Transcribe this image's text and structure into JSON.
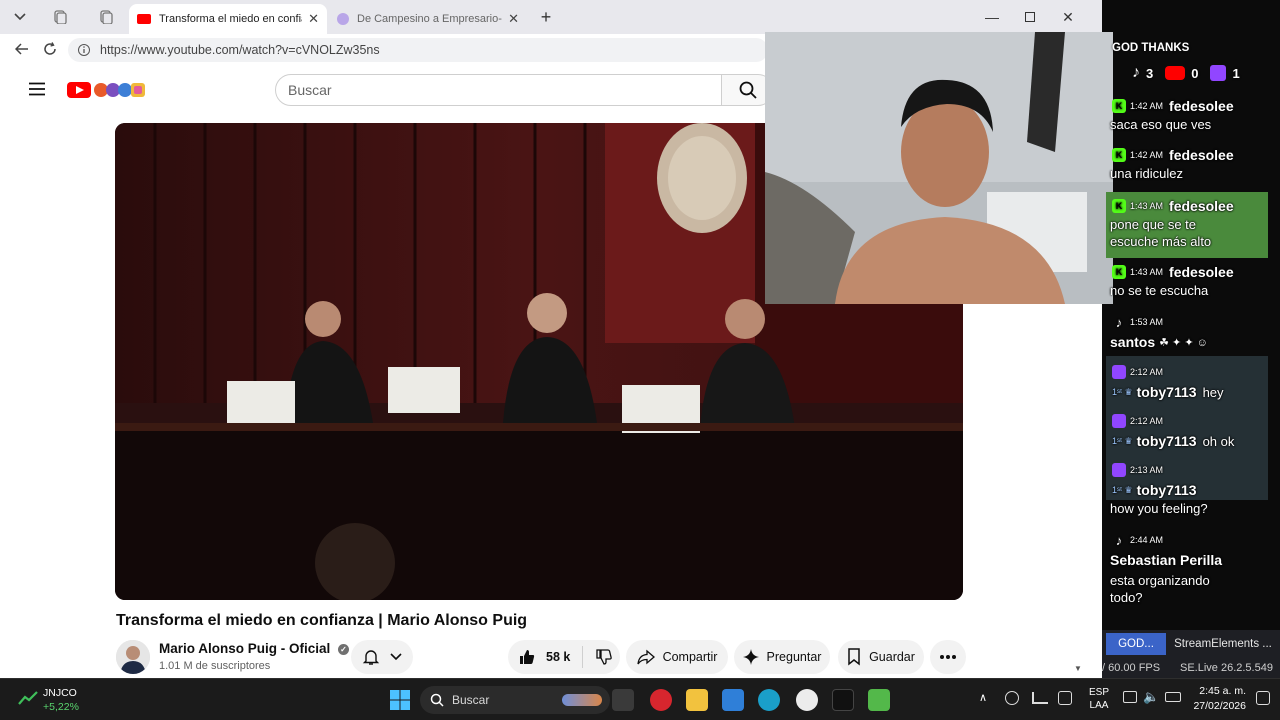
{
  "browser": {
    "tabs": [
      {
        "title": "Transforma el miedo en confianza",
        "active": true,
        "favicon_color": "#ff0000"
      },
      {
        "title": "De Campesino a Empresario- cómo",
        "active": false,
        "favicon_color": "#b9a6e8"
      }
    ],
    "new_tab_label": "+",
    "url": "https://www.youtube.com/watch?v=cVNOLZw35ns"
  },
  "youtube": {
    "search_placeholder": "Buscar",
    "video_title": "Transforma el miedo en confianza | Mario Alonso Puig",
    "channel_name": "Mario Alonso Puig - Oficial",
    "subscribers": "1.01 M de suscriptores",
    "likes": "58 k",
    "share_label": "Compartir",
    "ask_label": "Preguntar",
    "save_label": "Guardar"
  },
  "stream_overlay": {
    "banner": "GOD THANKS",
    "counts": {
      "tiktok": "3",
      "youtube": "0",
      "twitch": "1"
    },
    "messages": [
      {
        "platform": "kick",
        "time": "1:42 AM",
        "user": "fedesolee",
        "text": "saca eso que ves",
        "highlight": false
      },
      {
        "platform": "kick",
        "time": "1:42 AM",
        "user": "fedesolee",
        "text": "una ridiculez",
        "highlight": false
      },
      {
        "platform": "kick",
        "time": "1:43 AM",
        "user": "fedesolee",
        "text": "pone que se te escuche más alto",
        "highlight": true
      },
      {
        "platform": "kick",
        "time": "1:43 AM",
        "user": "fedesolee",
        "text": "no se te escucha",
        "highlight": false
      },
      {
        "platform": "tiktok",
        "time": "1:53 AM",
        "user": "santos",
        "text": "",
        "highlight": false
      },
      {
        "platform": "twitch",
        "time": "2:12 AM",
        "user": "toby7113",
        "text": "hey",
        "highlight": false,
        "inline": true
      },
      {
        "platform": "twitch",
        "time": "2:12 AM",
        "user": "toby7113",
        "text": "oh ok",
        "highlight": false,
        "inline": true
      },
      {
        "platform": "twitch",
        "time": "2:13 AM",
        "user": "toby7113",
        "text": "how you feeling?",
        "highlight": false
      },
      {
        "platform": "tiktok",
        "time": "2:44 AM",
        "user": "Sebastian Perilla",
        "text": "esta organizando todo?",
        "highlight": false
      }
    ],
    "obs_tabs": [
      "GOD...",
      "StreamElements ..."
    ],
    "fps": "/ 60.00 FPS",
    "version": "SE.Live 26.2.5.549"
  },
  "taskbar": {
    "stock_symbol": "JNJCO",
    "stock_change": "+5,22%",
    "search_label": "Buscar",
    "lang_top": "ESP",
    "lang_bottom": "LAA",
    "time": "2:45 a. m.",
    "date": "27/02/2026"
  }
}
